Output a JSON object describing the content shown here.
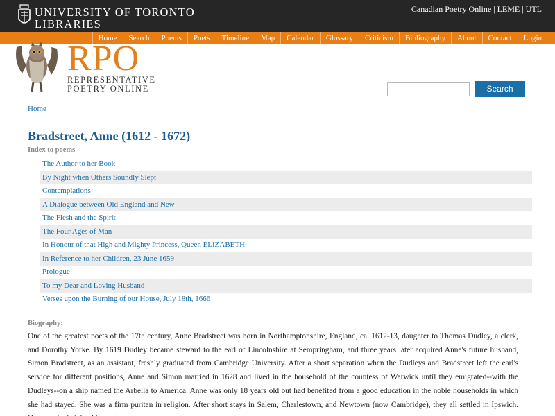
{
  "header": {
    "university_line1": "UNIVERSITY  OF  TORONTO",
    "university_line2": "LIBRARIES",
    "top_links": [
      "Canadian Poetry Online",
      "LEME",
      "UTL"
    ],
    "top_separator": " | "
  },
  "nav": {
    "items": [
      "Home",
      "Search",
      "Poems",
      "Poets",
      "Timeline",
      "Map",
      "Calendar",
      "Glossary",
      "Criticism",
      "Bibliography",
      "About",
      "Contact",
      "Login"
    ]
  },
  "logo": {
    "big": "RPO",
    "sub_line1": "REPRESENTATIVE",
    "sub_line2": "POETRY  ONLINE",
    "icon": "owl-icon"
  },
  "search": {
    "value": "",
    "placeholder": "",
    "button_label": "Search"
  },
  "breadcrumb": {
    "home": "Home"
  },
  "poet": {
    "title": "Bradstreet, Anne (1612 - 1672)",
    "index_label": "Index to poems",
    "poems": [
      "The Author to her Book",
      "By Night when Others Soundly Slept",
      "Contemplations",
      "A Dialogue between Old England and New",
      "The Flesh and the Spirit",
      "The Four Ages of Man",
      "In Honour of that High and Mighty Princess, Queen ELIZABETH",
      "In Reference to her Children, 23 June 1659",
      "Prologue",
      "To my Dear and Loving Husband",
      "Verses upon the Burning of our House, July 18th, 1666"
    ],
    "bio_label": "Biography:",
    "bio": "One of the greatest poets of the 17th century, Anne Bradstreet was born in Northamptonshire, England, ca. 1612-13, daughter to Thomas Dudley, a clerk, and Dorothy Yorke. By 1619 Dudley became steward to the earl of Lincolnshire at Sempringham, and three years later acquired Anne's future husband, Simon Bradstreet, as an assistant, freshly graduated from Cambridge University. After a short separation when the Dudleys and Bradstreet left the earl's service for different positions, Anne and Simon married in 1628 and lived in the household of the countess of Warwick until they emigrated--with the Dudleys--on a ship named the Arbella to America. Anne was only 18 years old but had benefited from a good education in the noble households in which she had stayed. She was a firm puritan in religion. After short stays in Salem, Charlestown, and Newtown (now Cambridge), they all settled in Ipswich. Here she had eight children in an"
  },
  "colors": {
    "topbar": "#262626",
    "navbar": "#e97e14",
    "logo_orange": "#e3801c",
    "link_blue": "#1a6fa8",
    "title_blue": "#1f5e92",
    "row_alt": "#ececec"
  }
}
